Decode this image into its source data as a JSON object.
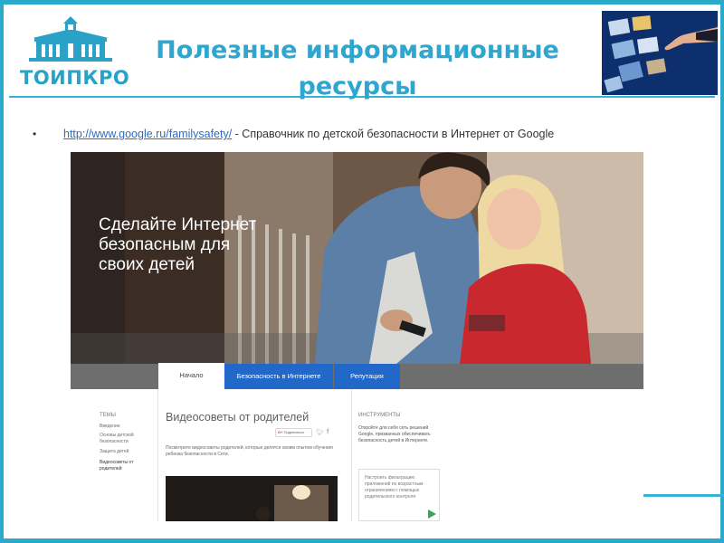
{
  "slide": {
    "title_line1": "Полезные информационные",
    "title_line2": "ресурсы",
    "logo_text": "ТОИПКРО"
  },
  "bullet": {
    "marker": "•",
    "link_text": "http://www.google.ru/familysafety/",
    "description": " - Справочник по детской безопасности в Интернет от Google"
  },
  "screenshot": {
    "hero_text": "Сделайте Интернет безопасным для своих детей",
    "tabs": [
      "Начало",
      "Безопасность в Интернете",
      "Репутация"
    ],
    "sidebar": {
      "title": "ТЕМЫ",
      "items": [
        "Введение",
        "Основы детской безопасности",
        "Защита детей",
        "Видеосоветы от родителей"
      ]
    },
    "main": {
      "heading": "Видеосоветы от родителей",
      "share_label": "Поделиться",
      "paragraph": "Посмотрите видеосоветы родителей, которые делятся своим опытом обучения ребенка безопасности в Сети."
    },
    "tools": {
      "title": "ИНСТРУМЕНТЫ",
      "paragraph": "Откройте для себя сеть решений Google, призванных обеспечивать безопасность детей в Интернете.",
      "box_text": "Настроить фильтрацию приложений по возрастным ограничениям с помощью родительского контроля"
    }
  },
  "colors": {
    "frame": "#2aa9c9",
    "title": "#2ea6d0",
    "link": "#2b6cc4",
    "tab_active": "#2168c9"
  }
}
